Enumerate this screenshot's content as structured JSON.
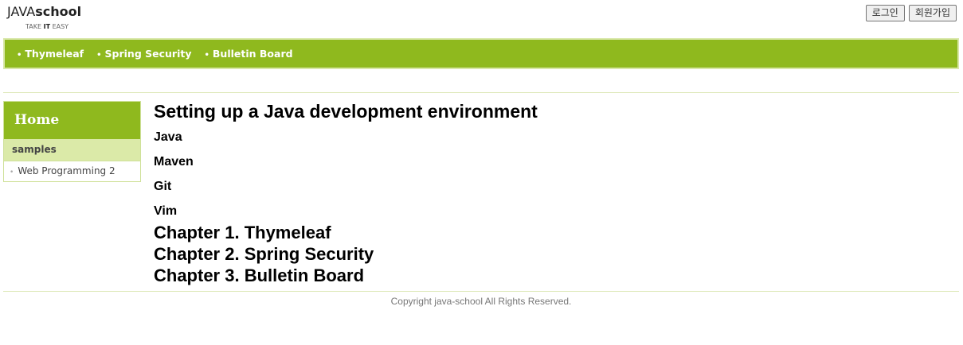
{
  "logo": {
    "light": "JAVA",
    "bold": "school",
    "tag_pre": "TAKE ",
    "tag_bold": "IT",
    "tag_post": " EASY"
  },
  "auth": {
    "login": "로그인",
    "signup": "회원가입"
  },
  "nav": {
    "bullet": "•",
    "items": [
      {
        "label": "Thymeleaf"
      },
      {
        "label": "Spring Security"
      },
      {
        "label": "Bulletin Board"
      }
    ]
  },
  "sidebar": {
    "home": "Home",
    "category": "samples",
    "bullet": "•",
    "links": [
      {
        "label": "Web Programming 2"
      }
    ]
  },
  "main": {
    "title": "Setting up a Java development environment",
    "sections": [
      "Java",
      "Maven",
      "Git",
      "Vim"
    ],
    "chapters": [
      "Chapter 1. Thymeleaf",
      "Chapter 2. Spring Security",
      "Chapter 3. Bulletin Board"
    ]
  },
  "footer": {
    "copyright": "Copyright java-school All Rights Reserved."
  },
  "colors": {
    "brand_green": "#8fb91e",
    "light_green": "#dbeaa8",
    "border_green": "#cfe199"
  }
}
